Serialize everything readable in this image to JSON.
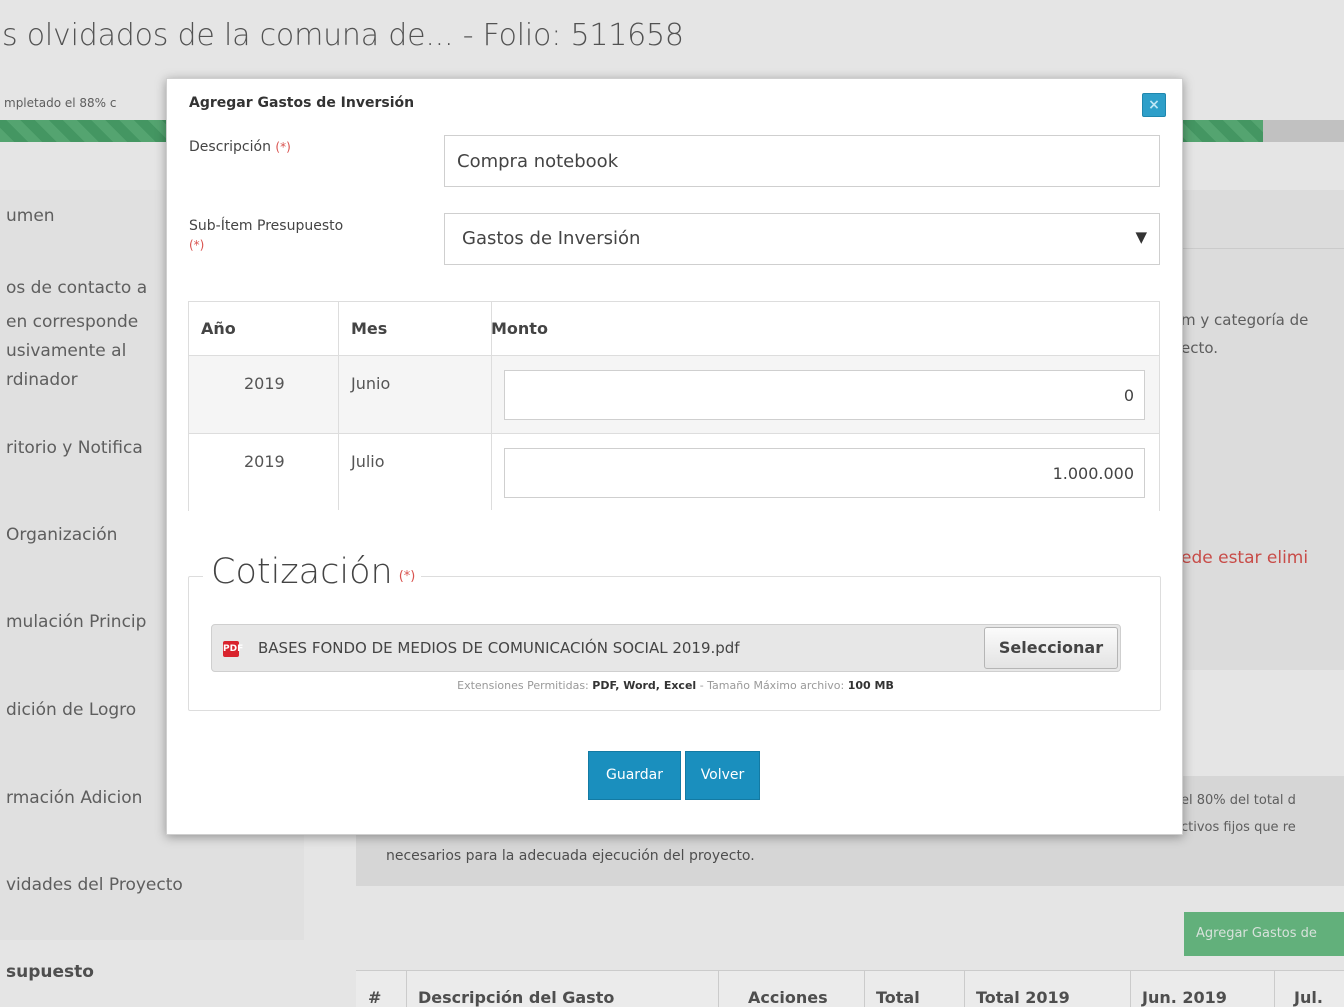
{
  "background": {
    "page_title": "s olvidados de la comuna de... - Folio: 511658",
    "progress_text": "mpletado el 88% c",
    "progress_fraction": 0.94,
    "sidebar": {
      "items": [
        "umen",
        "os de contacto a",
        "en corresponde",
        "usivamente al",
        "rdinador",
        "ritorio y Notifica",
        "Organización",
        "mulación Princip",
        "dición de Logro",
        "rmación Adicion",
        "vidades del Proyecto",
        "supuesto"
      ]
    },
    "right_texts": [
      "m y categoría de",
      "ecto.",
      "ede estar elimi",
      "el 80% del total d",
      "ctivos fijos que re"
    ],
    "info_text": "necesarios para la adecuada ejecución del proyecto.",
    "add_button_label": "Agregar Gastos de",
    "table_headers": [
      "#",
      "Descripción del Gasto",
      "Acciones",
      "Total",
      "Total 2019",
      "Jun. 2019",
      "Jul."
    ]
  },
  "modal": {
    "title": "Agregar Gastos de Inversión",
    "close_glyph": "×",
    "required_mark": "(*)",
    "description": {
      "label": "Descripción",
      "value": "Compra notebook"
    },
    "subitem": {
      "label": "Sub-Ítem Presupuesto",
      "selected": "Gastos de Inversión",
      "arrow": "▼"
    },
    "table": {
      "headers": [
        "Año",
        "Mes",
        "Monto"
      ],
      "rows": [
        {
          "year": "2019",
          "month": "Junio",
          "amount": "0"
        },
        {
          "year": "2019",
          "month": "Julio",
          "amount": "1.000.000"
        }
      ]
    },
    "cotizacion": {
      "legend": "Cotización",
      "file_icon_label": "PDF",
      "file_name": "BASES FONDO DE MEDIOS DE COMUNICACIÓN SOCIAL 2019.pdf",
      "select_label": "Seleccionar",
      "hint_prefix": "Extensiones Permitidas:",
      "hint_types": "PDF, Word, Excel",
      "hint_mid": "- Tamaño Máximo archivo:",
      "hint_size": "100 MB"
    },
    "buttons": {
      "save": "Guardar",
      "back": "Volver"
    }
  }
}
